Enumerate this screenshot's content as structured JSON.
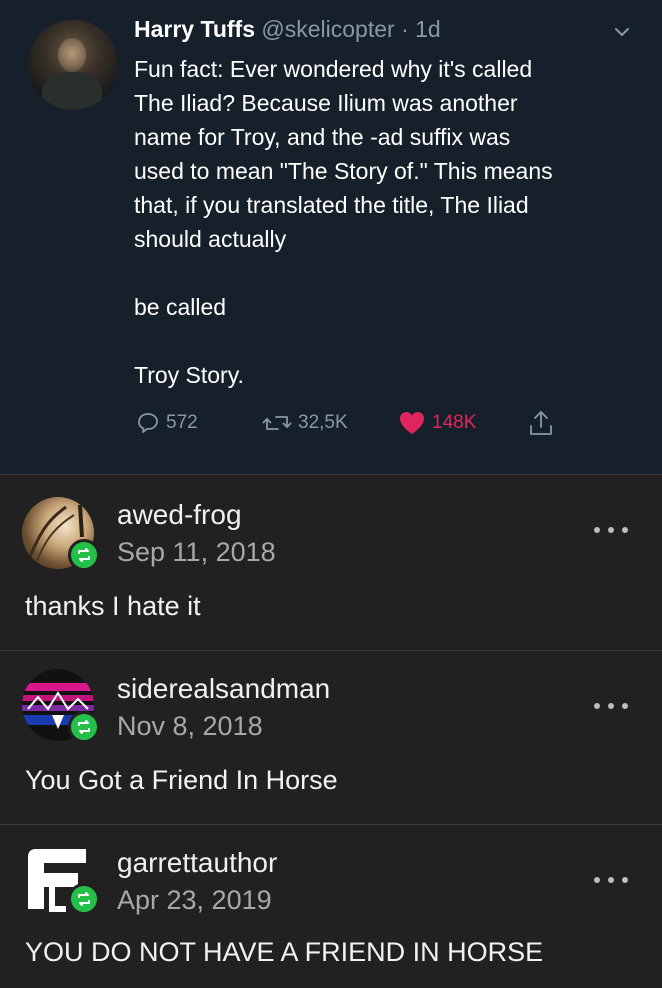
{
  "tweet": {
    "author_name": "Harry Tuffs",
    "handle": "@skelicopter",
    "separator": "·",
    "time": "1d",
    "lines": [
      "Fun fact: Ever wondered why it's called",
      "The Iliad? Because Ilium was another",
      "name for Troy, and the -ad suffix was",
      "used to mean \"The Story of.\" This means",
      "that, if you translated the title, The Iliad",
      "should actually"
    ],
    "line_be_called": "be called",
    "line_troy_story": "Troy Story.",
    "replies": "572",
    "retweets": "32,5K",
    "likes": "148K",
    "colors": {
      "background": "#15202b",
      "muted": "#8899a6",
      "like": "#e0245e"
    }
  },
  "posts": [
    {
      "username": "awed-frog",
      "date": "Sep 11, 2018",
      "body": "thanks I hate it"
    },
    {
      "username": "siderealsandman",
      "date": "Nov 8, 2018",
      "body": "You Got a Friend In Horse"
    },
    {
      "username": "garrettauthor",
      "date": "Apr 23, 2019",
      "body": "YOU DO NOT HAVE A FRIEND IN HORSE"
    }
  ],
  "icons": {
    "tweet_menu": "chevron-down-icon",
    "reply": "reply-icon",
    "retweet": "retweet-icon",
    "like": "heart-icon",
    "share": "share-icon",
    "reblog": "reblog-icon",
    "more": "more-options-icon"
  },
  "colors": {
    "reblog_badge": "#24c14a",
    "post_background": "#212121"
  }
}
